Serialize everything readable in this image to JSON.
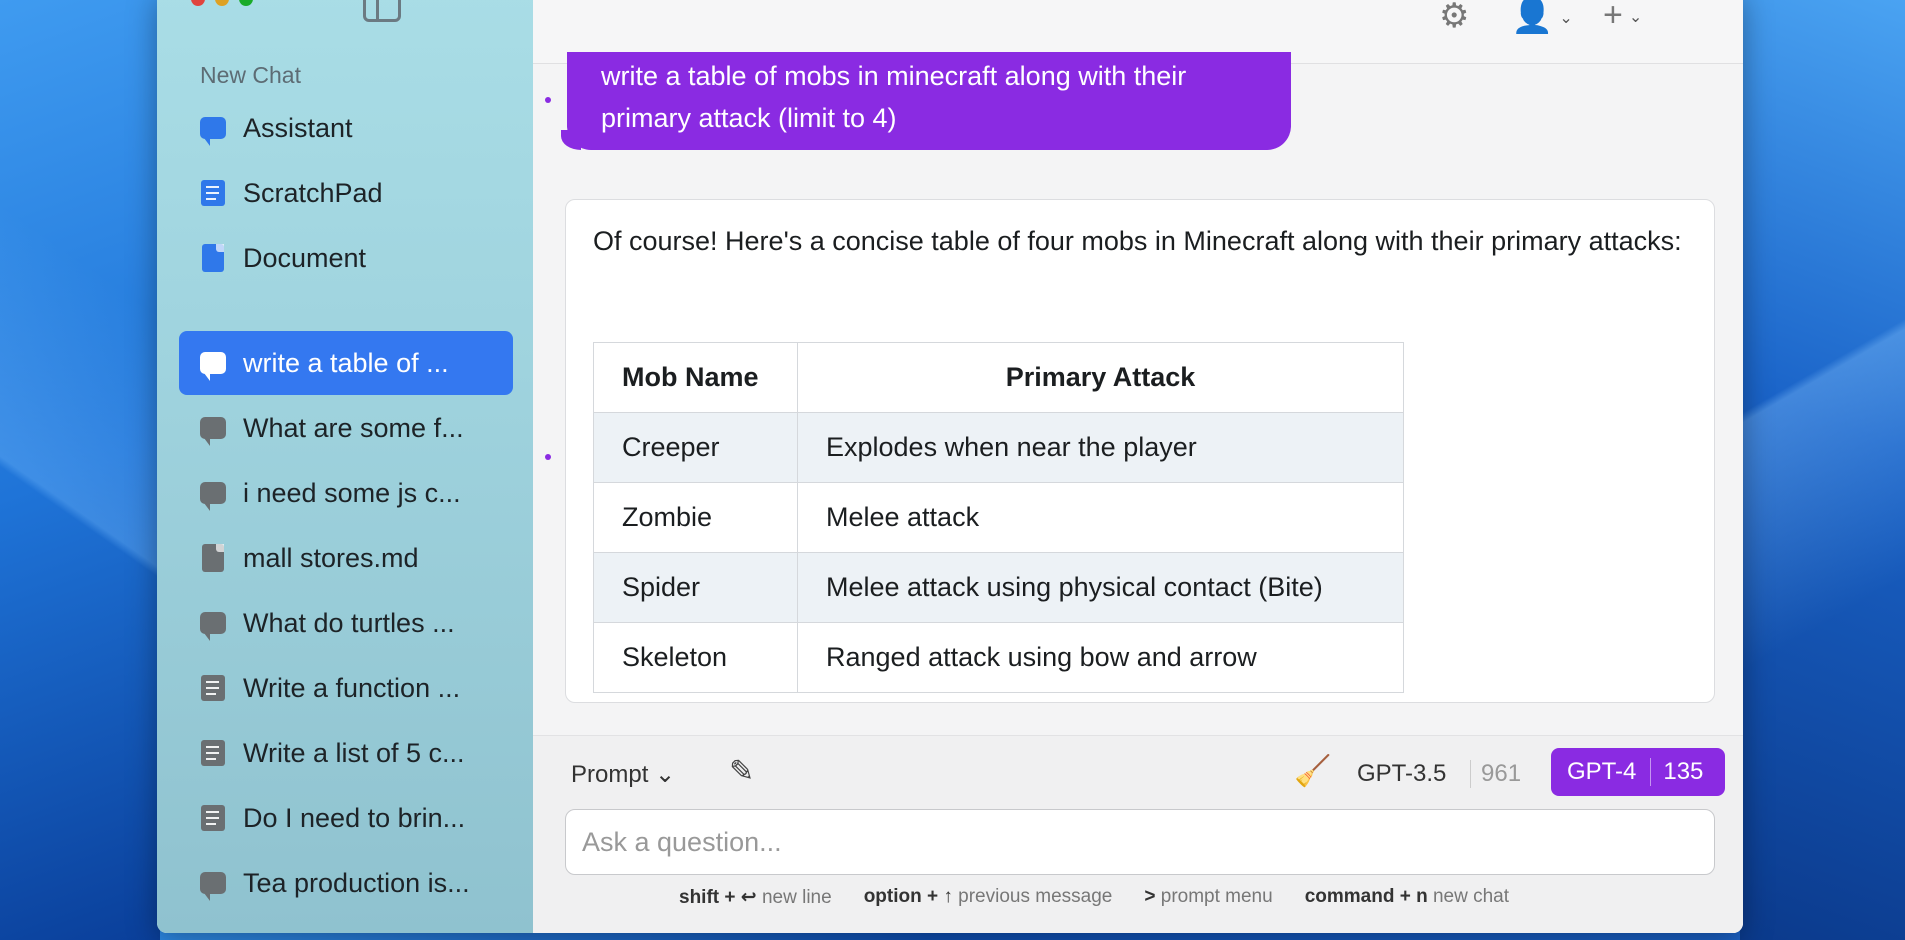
{
  "sidebar": {
    "new_chat_label": "New Chat",
    "top_items": [
      {
        "label": "Assistant",
        "icon": "chat-bubble-icon"
      },
      {
        "label": "ScratchPad",
        "icon": "scratchpad-icon"
      },
      {
        "label": "Document",
        "icon": "document-icon"
      }
    ],
    "history": [
      {
        "label": "write a table of ...",
        "icon": "chat-bubble-icon",
        "active": true
      },
      {
        "label": "What are some f...",
        "icon": "chat-bubble-icon"
      },
      {
        "label": "i need some js c...",
        "icon": "chat-bubble-icon"
      },
      {
        "label": "mall stores.md",
        "icon": "document-icon"
      },
      {
        "label": "What do turtles ...",
        "icon": "chat-bubble-icon"
      },
      {
        "label": "Write a function ...",
        "icon": "scratchpad-icon"
      },
      {
        "label": "Write a list of 5 c...",
        "icon": "scratchpad-icon"
      },
      {
        "label": "Do I need to brin...",
        "icon": "scratchpad-icon"
      },
      {
        "label": "Tea production is...",
        "icon": "chat-bubble-icon"
      }
    ]
  },
  "conversation": {
    "user_message": "write a table of mobs in minecraft along with their primary attack (limit to 4)",
    "assistant_intro": "Of course! Here's a concise table of four mobs in Minecraft along with their primary attacks:",
    "table": {
      "headers": [
        "Mob Name",
        "Primary Attack"
      ],
      "rows": [
        [
          "Creeper",
          "Explodes when near the player"
        ],
        [
          "Zombie",
          "Melee attack"
        ],
        [
          "Spider",
          "Melee attack using physical contact (Bite)"
        ],
        [
          "Skeleton",
          "Ranged attack using bow and arrow"
        ]
      ]
    }
  },
  "composer": {
    "prompt_label": "Prompt",
    "model_a": {
      "name": "GPT-3.5",
      "count": "961"
    },
    "model_b": {
      "name": "GPT-4",
      "count": "135"
    },
    "input_placeholder": "Ask a question...",
    "hints": [
      {
        "key": "shift + ↩",
        "text": "new line"
      },
      {
        "key": "option + ↑",
        "text": "previous message"
      },
      {
        "key": ">",
        "text": "prompt menu"
      },
      {
        "key": "command + n",
        "text": "new chat"
      }
    ]
  },
  "colors": {
    "accent": "#8a2be2",
    "sidebar_active": "#3478f0"
  }
}
